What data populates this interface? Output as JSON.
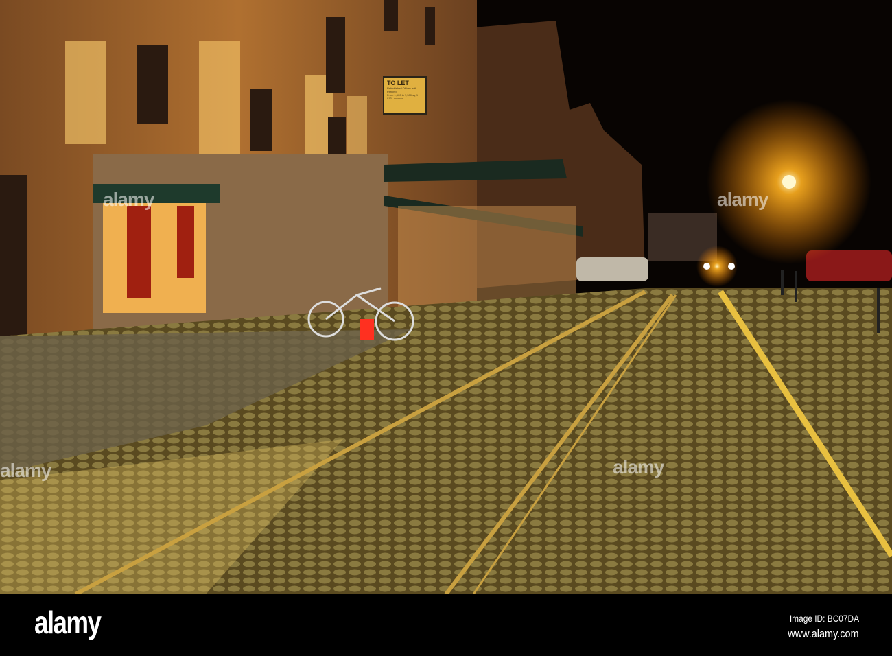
{
  "photo": {
    "description_alt": "Night street with cobblestones and tram rails beside lit warehouse building",
    "sign": {
      "title": "TO LET",
      "lines": [
        "Refurbished Offices with Parking",
        "From 1,500 to 7,500 sq ft",
        "0131 xx xxxx"
      ]
    },
    "watermark": "alamy"
  },
  "footer": {
    "logo": "alamy",
    "image_id": "Image ID: BC07DA",
    "url": "www.alamy.com"
  }
}
